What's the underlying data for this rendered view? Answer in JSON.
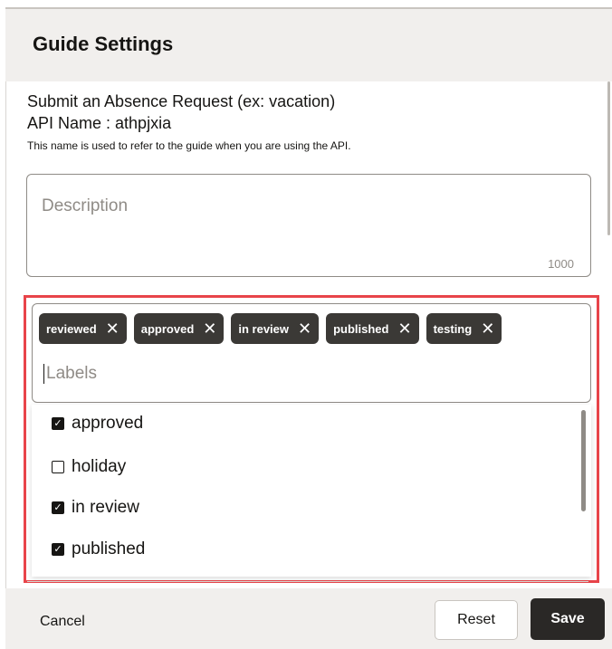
{
  "dialog": {
    "title": "Guide Settings"
  },
  "guide": {
    "name": "Submit an Absence Request (ex: vacation)",
    "api_name": "API Name : athpjxia",
    "api_help": "This name is used to refer to the guide when you are using the API."
  },
  "description": {
    "placeholder": "Description",
    "max_chars": "1000"
  },
  "labels": {
    "placeholder": "Labels",
    "chips": [
      "reviewed",
      "approved",
      "in review",
      "published",
      "testing"
    ],
    "options": [
      {
        "label": "approved",
        "checked": true
      },
      {
        "label": "holiday",
        "checked": false
      },
      {
        "label": "in review",
        "checked": true
      },
      {
        "label": "published",
        "checked": true
      }
    ]
  },
  "footer": {
    "cancel": "Cancel",
    "reset": "Reset",
    "save": "Save"
  },
  "colors": {
    "highlight_border": "#e8444a",
    "chip_bg": "#3b3936",
    "primary_button": "#2a2826"
  },
  "icons": {
    "chip_remove": "close-icon",
    "checked": "checkbox-checked-icon",
    "unchecked": "checkbox-empty-icon"
  }
}
